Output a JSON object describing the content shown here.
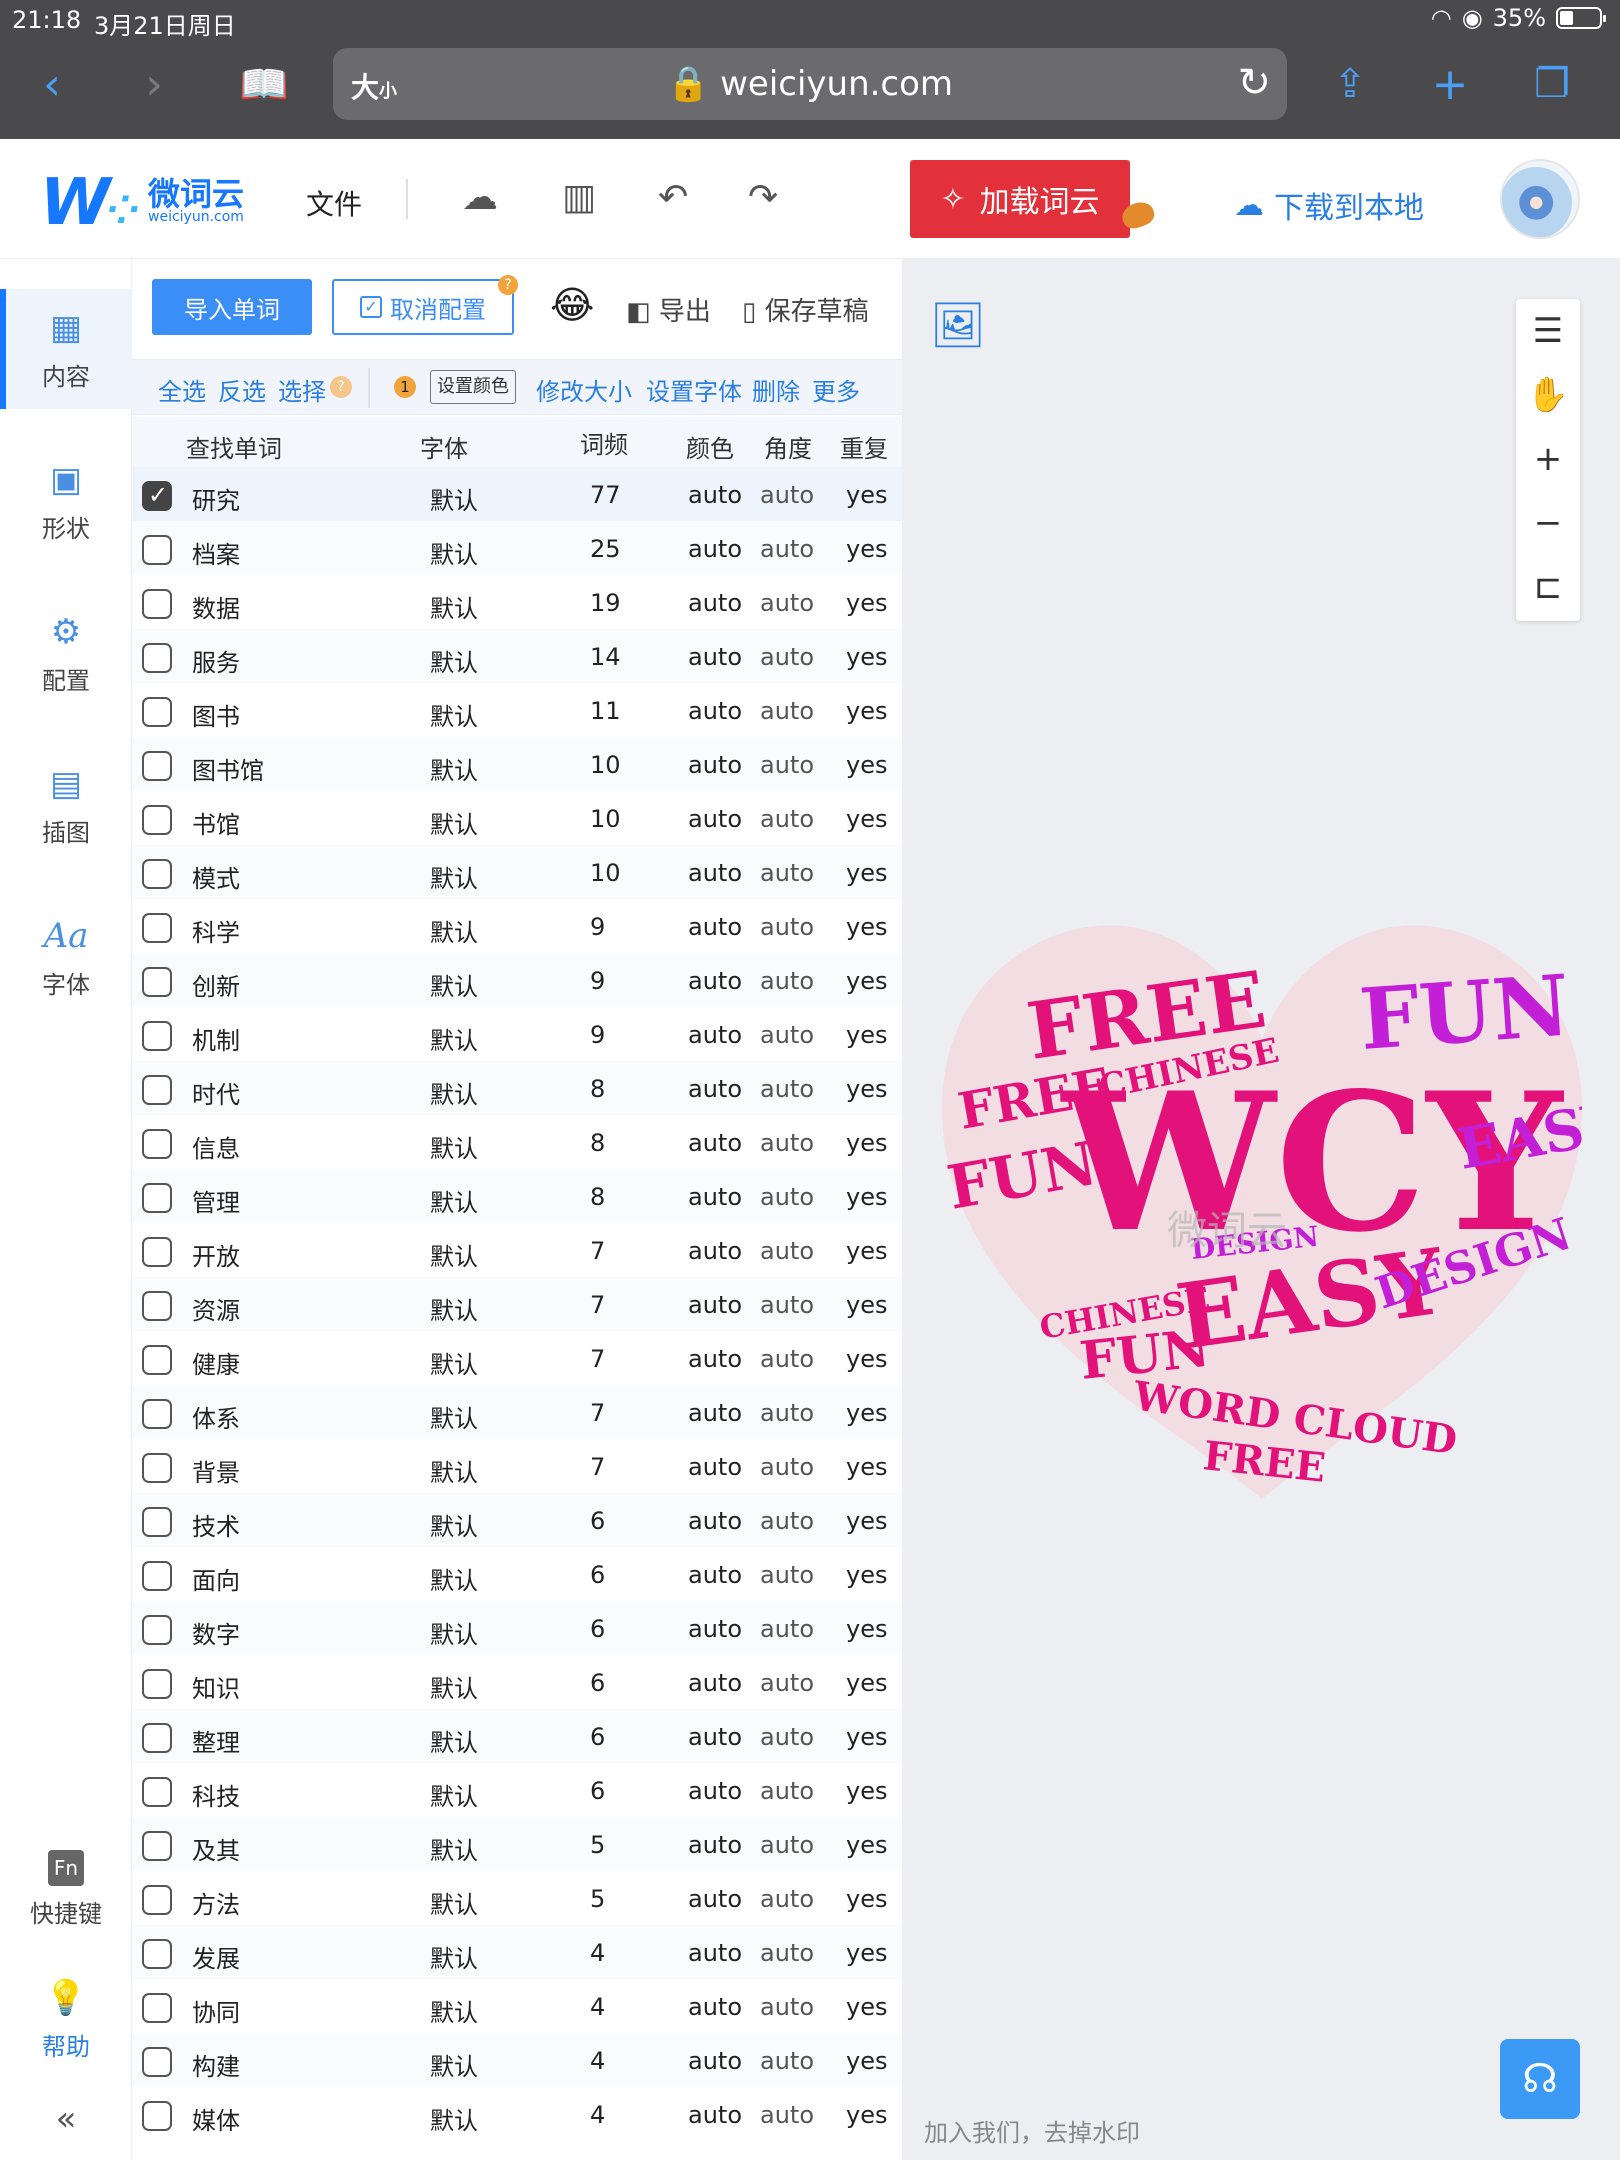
{
  "status": {
    "time": "21:18",
    "date": "3月21日周日",
    "battery": "35%",
    "battery_level": 0.35
  },
  "browser": {
    "text_size_label": "大",
    "text_size_small": "小",
    "url": "weiciyun.com"
  },
  "header": {
    "logo_cn": "微词云",
    "logo_sub": "weiciyun.com",
    "file_menu": "文件",
    "load_button": "加载词云",
    "download_button": "下载到本地"
  },
  "sidebar": {
    "items": [
      {
        "label": "内容",
        "icon": "content-icon"
      },
      {
        "label": "形状",
        "icon": "shape-icon"
      },
      {
        "label": "配置",
        "icon": "config-icon"
      },
      {
        "label": "插图",
        "icon": "illustration-icon"
      },
      {
        "label": "字体",
        "icon": "font-icon"
      }
    ],
    "shortcut_label": "快捷键",
    "shortcut_box": "Fn",
    "help_label": "帮助"
  },
  "panel": {
    "import_button": "导入单词",
    "cancel_config_button": "取消配置",
    "export_button": "导出",
    "save_draft_button": "保存草稿",
    "select_all": "全选",
    "invert": "反选",
    "select": "选择",
    "selected_count": "1",
    "set_color": "设置颜色",
    "resize": "修改大小",
    "set_font": "设置字体",
    "delete": "删除",
    "more": "更多"
  },
  "table": {
    "headers": {
      "word": "查找单词",
      "font": "字体",
      "freq": "词频",
      "color": "颜色",
      "angle": "角度",
      "repeat": "重复"
    },
    "rows": [
      {
        "word": "研究",
        "font": "默认",
        "freq": "77",
        "color": "auto",
        "angle": "auto",
        "repeat": "yes",
        "checked": true
      },
      {
        "word": "档案",
        "font": "默认",
        "freq": "25",
        "color": "auto",
        "angle": "auto",
        "repeat": "yes"
      },
      {
        "word": "数据",
        "font": "默认",
        "freq": "19",
        "color": "auto",
        "angle": "auto",
        "repeat": "yes"
      },
      {
        "word": "服务",
        "font": "默认",
        "freq": "14",
        "color": "auto",
        "angle": "auto",
        "repeat": "yes"
      },
      {
        "word": "图书",
        "font": "默认",
        "freq": "11",
        "color": "auto",
        "angle": "auto",
        "repeat": "yes"
      },
      {
        "word": "图书馆",
        "font": "默认",
        "freq": "10",
        "color": "auto",
        "angle": "auto",
        "repeat": "yes"
      },
      {
        "word": "书馆",
        "font": "默认",
        "freq": "10",
        "color": "auto",
        "angle": "auto",
        "repeat": "yes"
      },
      {
        "word": "模式",
        "font": "默认",
        "freq": "10",
        "color": "auto",
        "angle": "auto",
        "repeat": "yes"
      },
      {
        "word": "科学",
        "font": "默认",
        "freq": "9",
        "color": "auto",
        "angle": "auto",
        "repeat": "yes"
      },
      {
        "word": "创新",
        "font": "默认",
        "freq": "9",
        "color": "auto",
        "angle": "auto",
        "repeat": "yes"
      },
      {
        "word": "机制",
        "font": "默认",
        "freq": "9",
        "color": "auto",
        "angle": "auto",
        "repeat": "yes"
      },
      {
        "word": "时代",
        "font": "默认",
        "freq": "8",
        "color": "auto",
        "angle": "auto",
        "repeat": "yes"
      },
      {
        "word": "信息",
        "font": "默认",
        "freq": "8",
        "color": "auto",
        "angle": "auto",
        "repeat": "yes"
      },
      {
        "word": "管理",
        "font": "默认",
        "freq": "8",
        "color": "auto",
        "angle": "auto",
        "repeat": "yes"
      },
      {
        "word": "开放",
        "font": "默认",
        "freq": "7",
        "color": "auto",
        "angle": "auto",
        "repeat": "yes"
      },
      {
        "word": "资源",
        "font": "默认",
        "freq": "7",
        "color": "auto",
        "angle": "auto",
        "repeat": "yes"
      },
      {
        "word": "健康",
        "font": "默认",
        "freq": "7",
        "color": "auto",
        "angle": "auto",
        "repeat": "yes"
      },
      {
        "word": "体系",
        "font": "默认",
        "freq": "7",
        "color": "auto",
        "angle": "auto",
        "repeat": "yes"
      },
      {
        "word": "背景",
        "font": "默认",
        "freq": "7",
        "color": "auto",
        "angle": "auto",
        "repeat": "yes"
      },
      {
        "word": "技术",
        "font": "默认",
        "freq": "6",
        "color": "auto",
        "angle": "auto",
        "repeat": "yes"
      },
      {
        "word": "面向",
        "font": "默认",
        "freq": "6",
        "color": "auto",
        "angle": "auto",
        "repeat": "yes"
      },
      {
        "word": "数字",
        "font": "默认",
        "freq": "6",
        "color": "auto",
        "angle": "auto",
        "repeat": "yes"
      },
      {
        "word": "知识",
        "font": "默认",
        "freq": "6",
        "color": "auto",
        "angle": "auto",
        "repeat": "yes"
      },
      {
        "word": "整理",
        "font": "默认",
        "freq": "6",
        "color": "auto",
        "angle": "auto",
        "repeat": "yes"
      },
      {
        "word": "科技",
        "font": "默认",
        "freq": "6",
        "color": "auto",
        "angle": "auto",
        "repeat": "yes"
      },
      {
        "word": "及其",
        "font": "默认",
        "freq": "5",
        "color": "auto",
        "angle": "auto",
        "repeat": "yes"
      },
      {
        "word": "方法",
        "font": "默认",
        "freq": "5",
        "color": "auto",
        "angle": "auto",
        "repeat": "yes"
      },
      {
        "word": "发展",
        "font": "默认",
        "freq": "4",
        "color": "auto",
        "angle": "auto",
        "repeat": "yes"
      },
      {
        "word": "协同",
        "font": "默认",
        "freq": "4",
        "color": "auto",
        "angle": "auto",
        "repeat": "yes"
      },
      {
        "word": "构建",
        "font": "默认",
        "freq": "4",
        "color": "auto",
        "angle": "auto",
        "repeat": "yes"
      },
      {
        "word": "媒体",
        "font": "默认",
        "freq": "4",
        "color": "auto",
        "angle": "auto",
        "repeat": "yes"
      }
    ]
  },
  "canvas": {
    "watermark_text": "加入我们，去掉水印",
    "cloud_watermark": "微词云",
    "wordcloud_words": [
      "WCY",
      "FREE",
      "FUN",
      "EASY",
      "CHINESE",
      "DESIGN",
      "WORD CLOUD"
    ],
    "colors": {
      "primary": "#e3117a",
      "secondary": "#c21fd6",
      "heart_bg": "#f2dde3"
    }
  },
  "colors": {
    "accent": "#1677ff",
    "load_red": "#e3313b",
    "chrome_bg": "#4a4a4c"
  }
}
